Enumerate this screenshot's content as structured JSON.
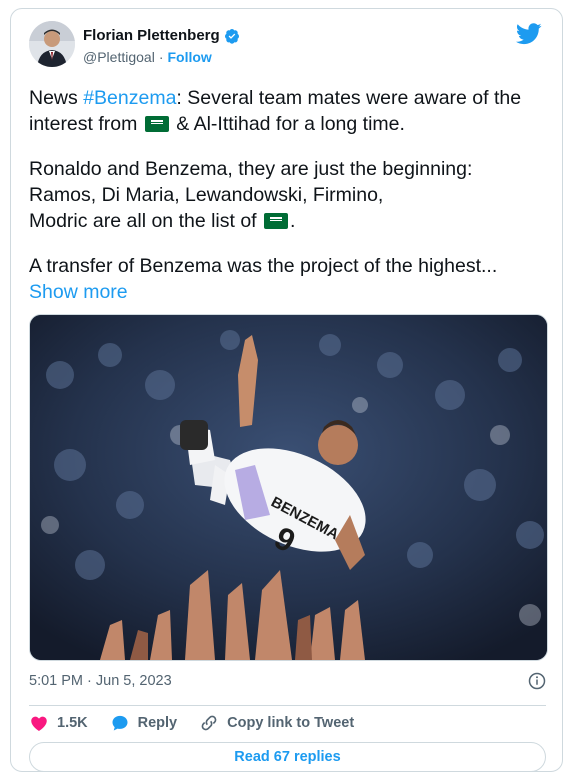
{
  "author": {
    "name": "Florian Plettenberg",
    "handle": "@Plettigoal",
    "separator": "·",
    "follow_label": "Follow"
  },
  "tweet": {
    "p1_prefix": "News ",
    "p1_hashtag": "#Benzema",
    "p1_text_a": ": Several team mates were aware of the interest from ",
    "p1_text_b": " & Al-Ittihad for a long time.",
    "p2_line1": "Ronaldo and Benzema, they are just the beginning:",
    "p2_line2": "Ramos, Di Maria, Lewandowski, Firmino,",
    "p2_line3_a": "Modric are all on the list of ",
    "p2_line3_b": ".",
    "p3_text": "A transfer of Benzema was the project of the highest... ",
    "show_more": "Show more"
  },
  "photo": {
    "jersey_name": "BENZEMA",
    "jersey_number": "9"
  },
  "meta": {
    "timestamp": "5:01 PM · Jun 5, 2023"
  },
  "actions": {
    "likes": "1.5K",
    "reply": "Reply",
    "copy_link": "Copy link to Tweet"
  },
  "read_replies": "Read 67 replies",
  "colors": {
    "accent": "#1d9bf0",
    "like": "#f91880",
    "saudi_green": "#006c35"
  }
}
